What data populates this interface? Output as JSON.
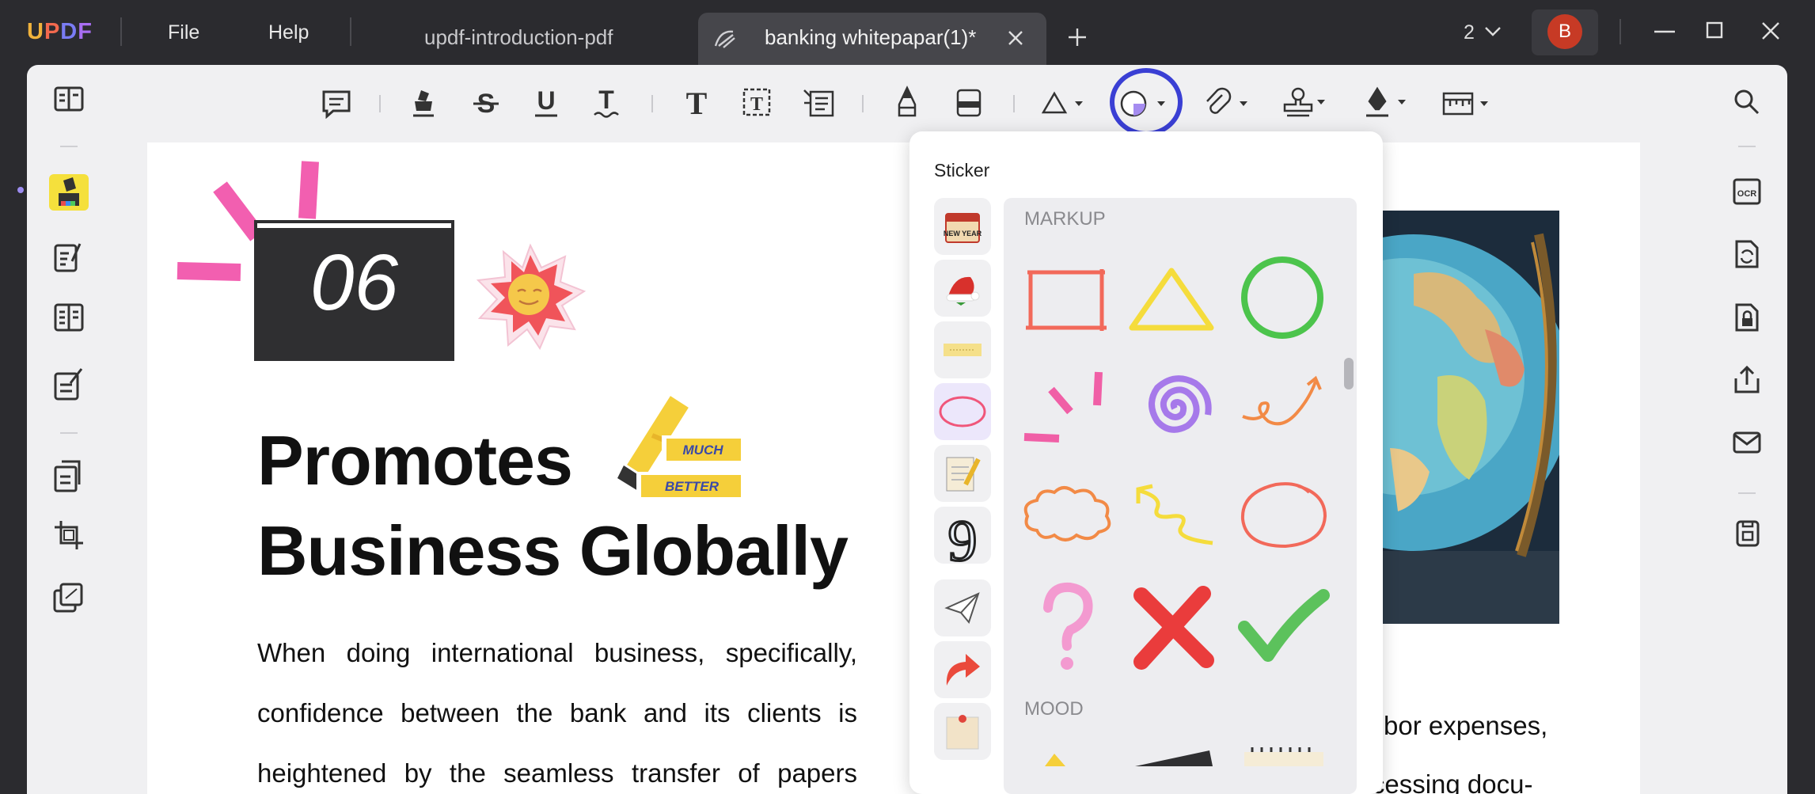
{
  "app": {
    "logo": [
      "U",
      "P",
      "D",
      "F"
    ]
  },
  "menu": {
    "file": "File",
    "help": "Help"
  },
  "tabs": [
    {
      "label": "updf-introduction-pdf",
      "active": false
    },
    {
      "label": "banking whitepapar(1)*",
      "active": true
    }
  ],
  "titlebar": {
    "window_count": "2",
    "user_initial": "B",
    "avatar_color": "#c73a25"
  },
  "document": {
    "number": "06",
    "heading_line1": "Promotes",
    "heading_line2": "Business Globally",
    "body_lines": [
      "When doing international business, specifically,",
      "confidence between the bank and its clients is",
      "heightened by the seamless transfer of papers"
    ],
    "right_line1": "bor expenses,",
    "right_line2": "and expenditures associated with processing docu-",
    "sticker_text": {
      "much": "MUCH",
      "better": "BETTER"
    }
  },
  "sticker_panel": {
    "title": "Sticker",
    "section_markup": "MARKUP",
    "section_mood": "MOOD",
    "categories": [
      "new-year",
      "christmas",
      "tape",
      "markup",
      "notepad",
      "number",
      "paper-plane",
      "arrow",
      "memo"
    ],
    "category_newyear_text": "NEW YEAR",
    "markup_items": [
      "rectangle",
      "triangle",
      "circle",
      "burst-lines",
      "spiral",
      "curly-arrow",
      "cloud",
      "zigzag-arrow",
      "oval",
      "question-mark",
      "cross",
      "checkmark"
    ]
  },
  "colors": {
    "accent": "#3a3fd4",
    "highlight": "#f5e03c",
    "selected_category": "#ece7fb"
  }
}
